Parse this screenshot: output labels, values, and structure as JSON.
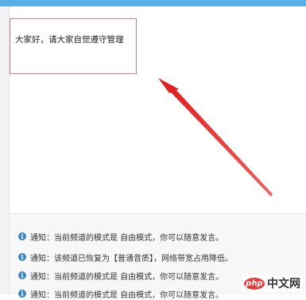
{
  "announcement": {
    "text": "大家好，请大家自觉遵守管理"
  },
  "messages": [
    {
      "icon": "info-icon",
      "text": "通知：当前频道的模式是 自由模式，你可以随意发言。"
    },
    {
      "icon": "info-icon",
      "text": "通知：该频道已恢复为【普通音质】，网络带宽占用降低。"
    },
    {
      "icon": "info-icon",
      "text": "通知：当前频道的模式是 自由模式，你可以随意发言。"
    },
    {
      "icon": "info-icon",
      "text": "通知：当前频道的模式是 自由模式，你可以随意发言。"
    }
  ],
  "watermark": {
    "logo": "php",
    "site": "中文网"
  },
  "colors": {
    "top_bar": "#5aaee6",
    "highlight_box": "#e47a7a",
    "arrow": "#e02020",
    "info_icon": "#3a86c8"
  }
}
